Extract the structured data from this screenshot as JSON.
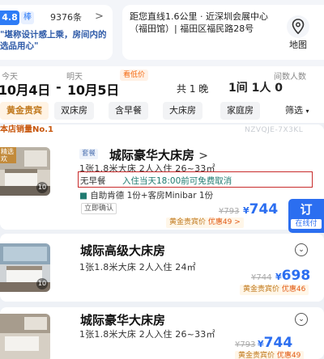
{
  "review": {
    "score": "4.8",
    "tag": "棒",
    "count": "9376条",
    "arrow": ">",
    "quote": "\"堪称设计感上乘，房间内的选品用心\""
  },
  "location": {
    "text": "距您直线1.6公里 · 近深圳会展中心（福田馆）| 福田区福民路28号",
    "map_label": "地图"
  },
  "dates": {
    "today_label": "今天",
    "tomorrow_label": "明天",
    "special_tag": "看低价",
    "checkin": "10月4日",
    "separator": "-",
    "checkout": "10月5日",
    "nights": "共 1 晚",
    "occupancy_label": "间数人数",
    "occupancy": "1间 1人 0"
  },
  "filters": {
    "items": [
      "黄金贵宾",
      "双床房",
      "含早餐",
      "大床房",
      "家庭房"
    ],
    "sort": "筛选"
  },
  "rooms": [
    {
      "rank_label": "本店销量No.1",
      "code": "NZVQJE-7X3KL",
      "photo_tag": "精选欢",
      "photo_count": "10",
      "package_tag": "套餐",
      "name": "城际豪华大床房",
      "info": "1张1.8米大床   2人入住   26~33㎡",
      "no_breakfast": "无早餐",
      "cancel_policy": "入住当天18:00前可免费取消",
      "amenities": "自助肯德 1份+客房Minibar 1份",
      "confirm": "立即确认",
      "old_price": "¥793",
      "currency": "¥",
      "price": "744",
      "gold_label": "黄金贵宾价",
      "discount": "优惠49 >",
      "book_label": "订",
      "book_sub": "在线付"
    },
    {
      "photo_count": "10",
      "name": "城际高级大床房",
      "info": "1张1.8米大床   2人入住   24㎡",
      "old_price": "¥744",
      "currency": "¥",
      "price": "698",
      "gold_label": "黄金贵宾价",
      "discount": "优惠46"
    },
    {
      "name": "城际豪华大床房",
      "info": "1张1.8米大床   2人入住   26~33㎡",
      "old_price": "¥793",
      "currency": "¥",
      "price": "744",
      "gold_label": "黄金贵宾价",
      "discount": "优惠49"
    }
  ],
  "colors": {
    "accent": "#2b6ef0",
    "gold": "#c07a1f",
    "cancel": "#1f7a70",
    "highlight_box": "#c82b2b"
  }
}
